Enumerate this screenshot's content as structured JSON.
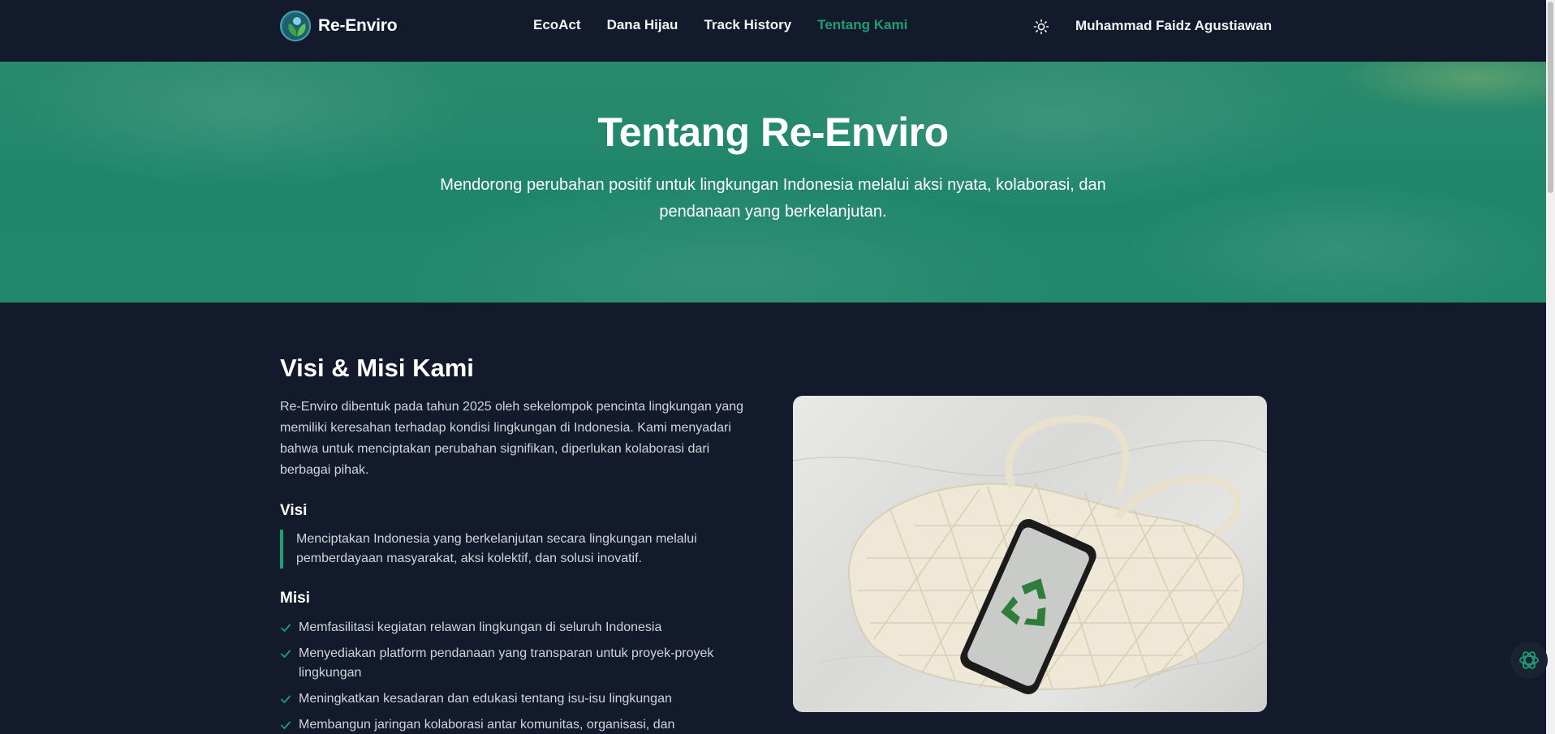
{
  "brand": {
    "name": "Re-Enviro",
    "logo_icon": "leaf-globe-logo"
  },
  "nav": {
    "links": [
      {
        "label": "EcoAct",
        "active": false
      },
      {
        "label": "Dana Hijau",
        "active": false
      },
      {
        "label": "Track History",
        "active": false
      },
      {
        "label": "Tentang Kami",
        "active": true
      }
    ],
    "theme_icon": "sun-icon",
    "user_name": "Muhammad Faidz Agustiawan"
  },
  "hero": {
    "title": "Tentang Re-Enviro",
    "subtitle": "Mendorong perubahan positif untuk lingkungan Indonesia melalui aksi nyata, kolaborasi, dan pendanaan yang berkelanjutan."
  },
  "about": {
    "title": "Visi & Misi Kami",
    "intro": "Re-Enviro dibentuk pada tahun 2025 oleh sekelompok pencinta lingkungan yang memiliki keresahan terhadap kondisi lingkungan di Indonesia. Kami menyadari bahwa untuk menciptakan perubahan signifikan, diperlukan kolaborasi dari berbagai pihak.",
    "visi_title": "Visi",
    "visi_text": "Menciptakan Indonesia yang berkelanjutan secara lingkungan melalui pemberdayaan masyarakat, aksi kolektif, dan solusi inovatif.",
    "misi_title": "Misi",
    "misi_items": [
      "Memfasilitasi kegiatan relawan lingkungan di seluruh Indonesia",
      "Menyediakan platform pendanaan yang transparan untuk proyek-proyek lingkungan",
      "Meningkatkan kesadaran dan edukasi tentang isu-isu lingkungan",
      "Membangun jaringan kolaborasi antar komunitas, organisasi, dan"
    ]
  },
  "colors": {
    "accent": "#1f9d76",
    "background": "#121a2b",
    "hero": "#22876c"
  },
  "chat_icon": "chatbot-icon"
}
